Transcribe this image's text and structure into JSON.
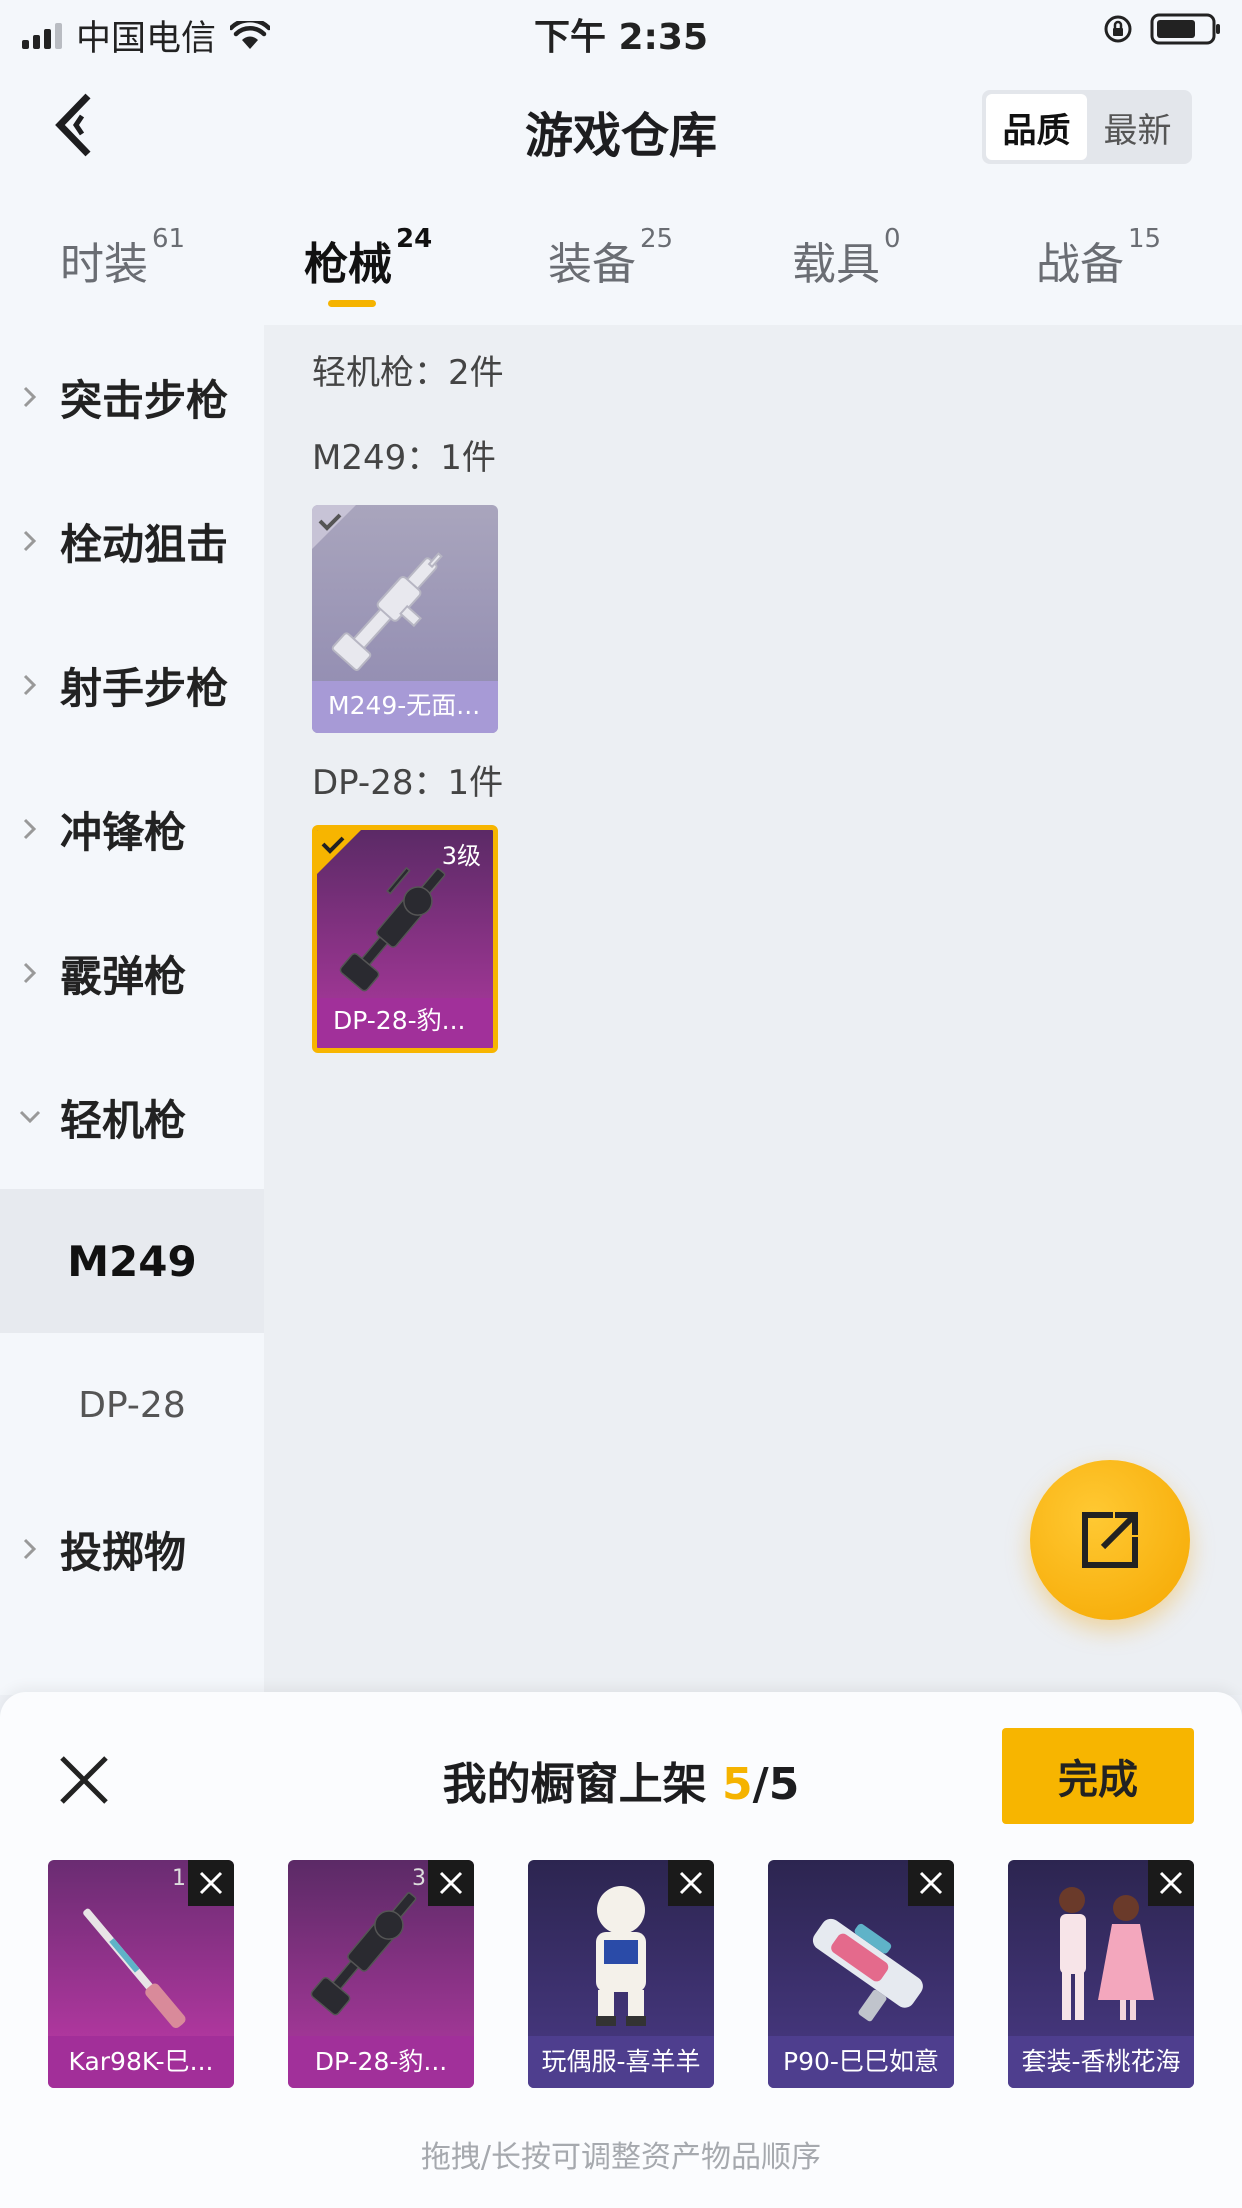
{
  "status_bar": {
    "carrier": "中国电信",
    "time": "下午 2:35"
  },
  "header": {
    "title": "游戏仓库",
    "sort_options": [
      "品质",
      "最新"
    ],
    "sort_selected": "品质"
  },
  "tabs": [
    {
      "label": "时装",
      "count": "61"
    },
    {
      "label": "枪械",
      "count": "24"
    },
    {
      "label": "装备",
      "count": "25"
    },
    {
      "label": "载具",
      "count": "0"
    },
    {
      "label": "战备",
      "count": "15"
    }
  ],
  "active_tab": "枪械",
  "sidebar": {
    "categories": [
      "突击步枪",
      "栓动狙击",
      "射手步枪",
      "冲锋枪",
      "霰弹枪",
      "轻机枪"
    ],
    "expanded": "轻机枪",
    "subitems": [
      "M249",
      "DP-28"
    ],
    "selected_subitem": "M249",
    "last_category": "投掷物"
  },
  "content": {
    "group_header": "轻机枪：2件",
    "groups": [
      {
        "label": "M249：1件",
        "items": [
          {
            "caption": "M249-无面...",
            "level": "",
            "selected": true,
            "rarity": "common"
          }
        ]
      },
      {
        "label": "DP-28：1件",
        "items": [
          {
            "caption": "DP-28-豹...",
            "level": "3级",
            "selected": true,
            "rarity": "epic"
          }
        ]
      }
    ]
  },
  "showcase": {
    "title_prefix": "我的橱窗上架",
    "count_current": "5",
    "count_total": "/5",
    "done_label": "完成",
    "items": [
      {
        "caption": "Kar98K-巳...",
        "level": "1",
        "rarity": "epic"
      },
      {
        "caption": "DP-28-豹...",
        "level": "3",
        "rarity": "epic"
      },
      {
        "caption": "玩偶服-喜羊羊",
        "level": "",
        "rarity": "rare"
      },
      {
        "caption": "P90-巳巳如意",
        "level": "",
        "rarity": "rare"
      },
      {
        "caption": "套装-香桃花海",
        "level": "",
        "rarity": "rare"
      }
    ],
    "hint": "拖拽/长按可调整资产物品顺序"
  },
  "colors": {
    "accent": "#f5b300",
    "epic_card": "#a3309b",
    "rare_card": "#3a2f66",
    "common_card": "#9d98b3"
  }
}
